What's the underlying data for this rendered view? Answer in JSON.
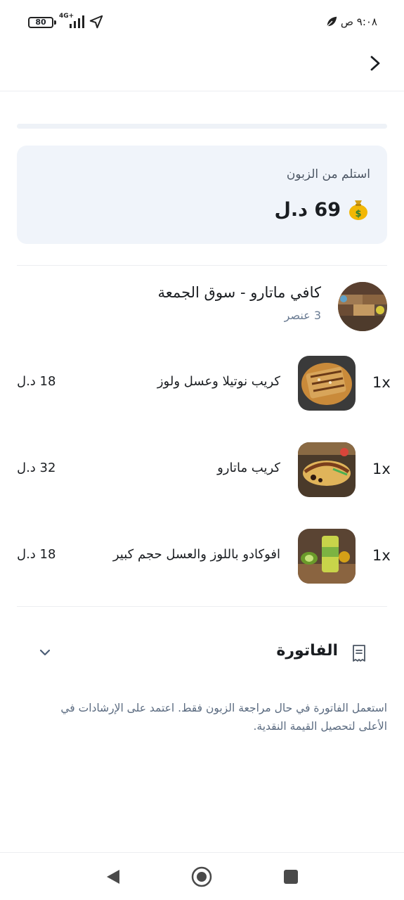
{
  "status_bar": {
    "battery": "80",
    "network": "4G+",
    "time": "٩:٠٨ ص",
    "icons": [
      "battery-icon",
      "signal-icon",
      "location-arrow-icon",
      "leaf-icon"
    ]
  },
  "header": {
    "back_icon": "chevron-right-icon"
  },
  "collect": {
    "label": "استلم من الزبون",
    "amount": "69 د.ل",
    "icon": "money-bag-icon"
  },
  "store": {
    "name": "كافي ماتارو - سوق الجمعة",
    "count": "3 عنصر"
  },
  "items": [
    {
      "qty": "1x",
      "name": "كريب نوتيلا وعسل ولوز",
      "price": "18 د.ل"
    },
    {
      "qty": "1x",
      "name": "كريب ماتارو",
      "price": "32 د.ل"
    },
    {
      "qty": "1x",
      "name": "افوكادو باللوز والعسل حجم كبير",
      "price": "18 د.ل"
    }
  ],
  "invoice": {
    "title": "الفاتورة",
    "note": "استعمل الفاتورة في حال مراجعة الزبون فقط. اعتمد على الإرشادات في الأعلى لتحصيل القيمة النقدية."
  },
  "system_nav": {
    "icons": [
      "back-triangle-icon",
      "home-circle-icon",
      "recents-square-icon"
    ]
  }
}
